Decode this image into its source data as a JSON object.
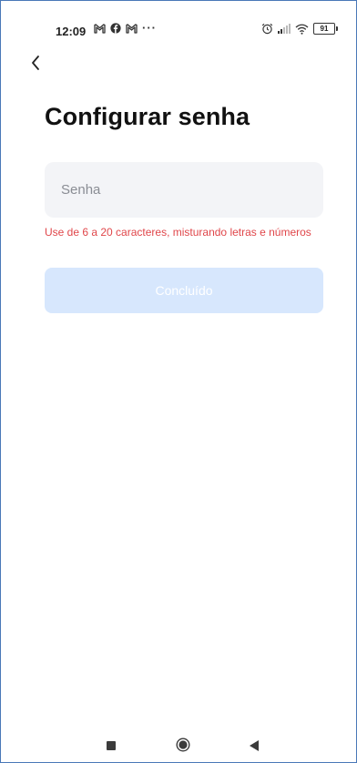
{
  "status_bar": {
    "time": "12:09",
    "left_icons": [
      "gmail-icon",
      "facebook-icon",
      "gmail-icon"
    ],
    "more": "···",
    "right_icons": [
      "alarm-icon",
      "signal-icon",
      "wifi-icon"
    ],
    "battery": "91"
  },
  "header": {
    "back_icon": "chevron-left-icon"
  },
  "main": {
    "title": "Configurar senha",
    "password_placeholder": "Senha",
    "password_value": "",
    "hint": "Use de 6 a 20 caracteres, misturando letras e números",
    "done_label": "Concluído"
  },
  "nav_bar": {
    "icons": [
      "recents-icon",
      "home-icon",
      "back-icon"
    ]
  },
  "colors": {
    "hint": "#e0464a",
    "button_disabled": "#d7e7fd",
    "field_bg": "#f3f4f7",
    "frame_border": "#4a78b8"
  }
}
